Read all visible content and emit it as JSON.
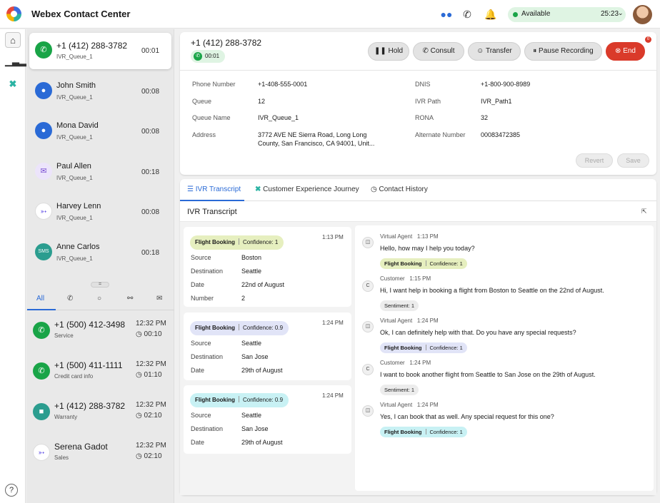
{
  "app": {
    "title": "Webex Contact Center"
  },
  "topbar": {
    "icons": [
      "webex-icon",
      "phone-icon",
      "bell-icon"
    ],
    "status": {
      "label": "Available",
      "timer": "25:23",
      "color": "#19a447"
    }
  },
  "rail": {
    "icons": [
      "home-icon",
      "stats-icon",
      "journey-icon",
      "help-icon"
    ]
  },
  "tasks": [
    {
      "name": "+1 (412) 288-3782",
      "queue": "IVR_Queue_1",
      "time": "00:01",
      "channel": "phone",
      "color": "#19a447"
    },
    {
      "name": "John Smith",
      "queue": "IVR_Queue_1",
      "time": "00:08",
      "channel": "chat",
      "color": "#2a6ad6"
    },
    {
      "name": "Mona David",
      "queue": "IVR_Queue_1",
      "time": "00:08",
      "channel": "chat",
      "color": "#2a6ad6"
    },
    {
      "name": "Paul Allen",
      "queue": "IVR_Queue_1",
      "time": "00:18",
      "channel": "email",
      "color": "#7b4fd3"
    },
    {
      "name": "Harvey Lenn",
      "queue": "IVR_Queue_1",
      "time": "00:08",
      "channel": "messenger",
      "color": "#6c5ce7"
    },
    {
      "name": "Anne Carlos",
      "queue": "IVR_Queue_1",
      "time": "00:18",
      "channel": "sms",
      "color": "#2b9d8f"
    }
  ],
  "filter_tabs": {
    "all": "All"
  },
  "history": [
    {
      "name": "+1 (500) 412-3498",
      "sub": "Service",
      "time": "12:32 PM",
      "duration": "00:10",
      "color": "#19a447"
    },
    {
      "name": "+1 (500) 411-1111",
      "sub": "Credit card info",
      "time": "12:32 PM",
      "duration": "01:10",
      "color": "#19a447"
    },
    {
      "name": "+1 (412) 288-3782",
      "sub": "Warranty",
      "time": "12:32 PM",
      "duration": "02:10",
      "color": "#2b9d8f"
    },
    {
      "name": "Serena Gadot",
      "sub": "Sales",
      "time": "12:32 PM",
      "duration": "02:10",
      "color": "#6c5ce7"
    }
  ],
  "call": {
    "number": "+1 (412) 288-3782",
    "timer": "00:01",
    "controls": {
      "hold": "Hold",
      "consult": "Consult",
      "transfer": "Transfer",
      "pause": "Pause Recording",
      "end": "End"
    },
    "end_badge": "0",
    "fields": {
      "phone_label": "Phone Number",
      "phone": "+1-408-555-0001",
      "queue_label": "Queue",
      "queue": "12",
      "queue_name_label": "Queue Name",
      "queue_name": "IVR_Queue_1",
      "address_label": "Address",
      "address_1": "3772 AVE NE Sierra Road, Long Long",
      "address_2": "County, San Francisco, CA 94001, Unit...",
      "dnis_label": "DNIS",
      "dnis": "+1-800-900-8989",
      "ivr_path_label": "IVR Path",
      "ivr_path": "IVR_Path1",
      "rona_label": "RONA",
      "rona": "32",
      "alt_label": "Alternate Number",
      "alt": "00083472385"
    },
    "revert": "Revert",
    "save": "Save"
  },
  "tabs": {
    "ivr": "IVR Transcript",
    "journey": "Customer Experience Journey",
    "history": "Contact History"
  },
  "transcript": {
    "title": "IVR Transcript",
    "intents": [
      {
        "intent": "Flight Booking",
        "confidence": "Confidence: 1",
        "time": "1:13 PM",
        "color": "#e6efbf",
        "rows": [
          [
            "Source",
            "Boston"
          ],
          [
            "Destination",
            "Seattle"
          ],
          [
            "Date",
            "22nd of August"
          ],
          [
            "Number",
            "2"
          ]
        ]
      },
      {
        "intent": "Flight Booking",
        "confidence": "Confidence: 0.9",
        "time": "1:24 PM",
        "color": "#e1e4f7",
        "rows": [
          [
            "Source",
            "Seattle"
          ],
          [
            "Destination",
            "San Jose"
          ],
          [
            "Date",
            "29th of August"
          ]
        ]
      },
      {
        "intent": "Flight Booking",
        "confidence": "Confidence: 0.9",
        "time": "1:24 PM",
        "color": "#c8f1f4",
        "rows": [
          [
            "Source",
            "Seattle"
          ],
          [
            "Destination",
            "San Jose"
          ],
          [
            "Date",
            "29th of August"
          ]
        ]
      }
    ],
    "messages": [
      {
        "speaker": "Virtual Agent",
        "time": "1:13 PM",
        "text": "Hello, how may I help you today?",
        "badge_intent": "Flight Booking",
        "badge_conf": "Confidence: 1",
        "badge_color": "#e6efbf",
        "icon": "bot"
      },
      {
        "speaker": "Customer",
        "time": "1:15 PM",
        "text": "Hi, I want help in booking a flight from Boston to Seattle on the 22nd of August.",
        "sentiment": "Sentiment: 1",
        "icon": "C"
      },
      {
        "speaker": "Virtual Agent",
        "time": "1:24 PM",
        "text": "Ok, I can definitely help with that. Do you have any special requests?",
        "badge_intent": "Flight Booking",
        "badge_conf": "Confidence: 1",
        "badge_color": "#e1e4f7",
        "icon": "bot"
      },
      {
        "speaker": "Customer",
        "time": "1:24 PM",
        "text": "I want to book another flight from Seattle to San Jose on the 29th of August.",
        "sentiment": "Sentiment: 1",
        "icon": "C"
      },
      {
        "speaker": "Virtual Agent",
        "time": "1:24 PM",
        "text": "Yes, I can book that as well. Any special request for this one?",
        "badge_intent": "Flight Booking",
        "badge_conf": "Confidence: 1",
        "badge_color": "#c8f1f4",
        "icon": "bot"
      }
    ]
  }
}
